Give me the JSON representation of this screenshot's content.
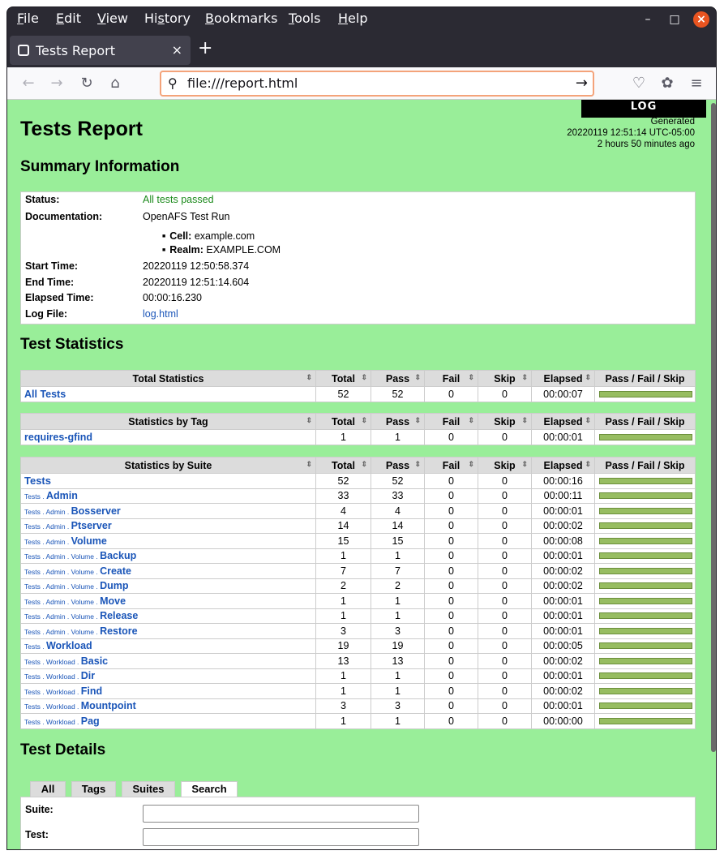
{
  "menu": [
    "File",
    "Edit",
    "View",
    "History",
    "Bookmarks",
    "Tools",
    "Help"
  ],
  "menu_access": [
    "F",
    "E",
    "V",
    "s",
    "B",
    "T",
    "H"
  ],
  "tab": {
    "title": "Tests Report"
  },
  "address": {
    "url": "file:///report.html"
  },
  "report": {
    "log_button": "LOG",
    "title": "Tests Report",
    "generated_label": "Generated",
    "generated_time": "20220119 12:51:14 UTC-05:00",
    "generated_ago": "2 hours 50 minutes ago",
    "summary_heading": "Summary Information",
    "summary": {
      "status_label": "Status:",
      "status_value": "All tests passed",
      "doc_label": "Documentation:",
      "doc_value": "OpenAFS Test Run",
      "cell_label": "Cell:",
      "cell_value": "example.com",
      "realm_label": "Realm:",
      "realm_value": "EXAMPLE.COM",
      "start_label": "Start Time:",
      "start_value": "20220119 12:50:58.374",
      "end_label": "End Time:",
      "end_value": "20220119 12:51:14.604",
      "elapsed_label": "Elapsed Time:",
      "elapsed_value": "00:00:16.230",
      "logfile_label": "Log File:",
      "logfile_value": "log.html"
    },
    "stats_heading": "Test Statistics",
    "columns": [
      "Total",
      "Pass",
      "Fail",
      "Skip",
      "Elapsed",
      "Pass / Fail / Skip"
    ],
    "total_stats": {
      "header": "Total Statistics",
      "rows": [
        {
          "name": "All Tests",
          "total": "52",
          "pass": "52",
          "fail": "0",
          "skip": "0",
          "elapsed": "00:00:07",
          "pass_ratio": 1.0
        }
      ]
    },
    "tag_stats": {
      "header": "Statistics by Tag",
      "rows": [
        {
          "name": "requires-gfind",
          "total": "1",
          "pass": "1",
          "fail": "0",
          "skip": "0",
          "elapsed": "00:00:01",
          "pass_ratio": 1.0
        }
      ]
    },
    "suite_stats": {
      "header": "Statistics by Suite",
      "rows": [
        {
          "prefix": "",
          "name": "Tests",
          "total": "52",
          "pass": "52",
          "fail": "0",
          "skip": "0",
          "elapsed": "00:00:16",
          "pass_ratio": 1.0
        },
        {
          "prefix": "Tests . ",
          "name": "Admin",
          "total": "33",
          "pass": "33",
          "fail": "0",
          "skip": "0",
          "elapsed": "00:00:11",
          "pass_ratio": 1.0
        },
        {
          "prefix": "Tests . Admin . ",
          "name": "Bosserver",
          "total": "4",
          "pass": "4",
          "fail": "0",
          "skip": "0",
          "elapsed": "00:00:01",
          "pass_ratio": 1.0
        },
        {
          "prefix": "Tests . Admin . ",
          "name": "Ptserver",
          "total": "14",
          "pass": "14",
          "fail": "0",
          "skip": "0",
          "elapsed": "00:00:02",
          "pass_ratio": 1.0
        },
        {
          "prefix": "Tests . Admin . ",
          "name": "Volume",
          "total": "15",
          "pass": "15",
          "fail": "0",
          "skip": "0",
          "elapsed": "00:00:08",
          "pass_ratio": 1.0
        },
        {
          "prefix": "Tests . Admin . Volume . ",
          "name": "Backup",
          "total": "1",
          "pass": "1",
          "fail": "0",
          "skip": "0",
          "elapsed": "00:00:01",
          "pass_ratio": 1.0
        },
        {
          "prefix": "Tests . Admin . Volume . ",
          "name": "Create",
          "total": "7",
          "pass": "7",
          "fail": "0",
          "skip": "0",
          "elapsed": "00:00:02",
          "pass_ratio": 1.0
        },
        {
          "prefix": "Tests . Admin . Volume . ",
          "name": "Dump",
          "total": "2",
          "pass": "2",
          "fail": "0",
          "skip": "0",
          "elapsed": "00:00:02",
          "pass_ratio": 1.0
        },
        {
          "prefix": "Tests . Admin . Volume . ",
          "name": "Move",
          "total": "1",
          "pass": "1",
          "fail": "0",
          "skip": "0",
          "elapsed": "00:00:01",
          "pass_ratio": 1.0
        },
        {
          "prefix": "Tests . Admin . Volume . ",
          "name": "Release",
          "total": "1",
          "pass": "1",
          "fail": "0",
          "skip": "0",
          "elapsed": "00:00:01",
          "pass_ratio": 1.0
        },
        {
          "prefix": "Tests . Admin . Volume . ",
          "name": "Restore",
          "total": "3",
          "pass": "3",
          "fail": "0",
          "skip": "0",
          "elapsed": "00:00:01",
          "pass_ratio": 1.0
        },
        {
          "prefix": "Tests . ",
          "name": "Workload",
          "total": "19",
          "pass": "19",
          "fail": "0",
          "skip": "0",
          "elapsed": "00:00:05",
          "pass_ratio": 1.0
        },
        {
          "prefix": "Tests . Workload . ",
          "name": "Basic",
          "total": "13",
          "pass": "13",
          "fail": "0",
          "skip": "0",
          "elapsed": "00:00:02",
          "pass_ratio": 1.0
        },
        {
          "prefix": "Tests . Workload . ",
          "name": "Dir",
          "total": "1",
          "pass": "1",
          "fail": "0",
          "skip": "0",
          "elapsed": "00:00:01",
          "pass_ratio": 1.0
        },
        {
          "prefix": "Tests . Workload . ",
          "name": "Find",
          "total": "1",
          "pass": "1",
          "fail": "0",
          "skip": "0",
          "elapsed": "00:00:02",
          "pass_ratio": 1.0
        },
        {
          "prefix": "Tests . Workload . ",
          "name": "Mountpoint",
          "total": "3",
          "pass": "3",
          "fail": "0",
          "skip": "0",
          "elapsed": "00:00:01",
          "pass_ratio": 1.0
        },
        {
          "prefix": "Tests . Workload . ",
          "name": "Pag",
          "total": "1",
          "pass": "1",
          "fail": "0",
          "skip": "0",
          "elapsed": "00:00:00",
          "pass_ratio": 1.0
        }
      ]
    },
    "details_heading": "Test Details",
    "details_tabs": [
      "All",
      "Tags",
      "Suites",
      "Search"
    ],
    "details_active_tab": "Search",
    "search": {
      "suite_label": "Suite:",
      "suite_value": "",
      "test_label": "Test:",
      "test_value": ""
    }
  },
  "colors": {
    "page_bg": "#99ee99",
    "pass_bar": "#97bd61",
    "link": "#1a55b8",
    "status_pass": "#1c8a1c"
  }
}
